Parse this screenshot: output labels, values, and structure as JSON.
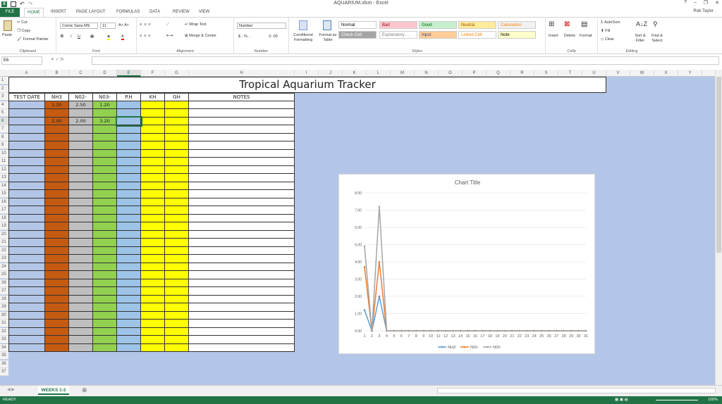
{
  "window": {
    "title": "AQUARIUM.xlsm - Excel",
    "user": "Rob Taylor"
  },
  "tabs": [
    "FILE",
    "HOME",
    "INSERT",
    "PAGE LAYOUT",
    "FORMULAS",
    "DATA",
    "REVIEW",
    "VIEW"
  ],
  "active_tab": "HOME",
  "ribbon": {
    "clipboard": {
      "paste": "Paste",
      "cut": "Cut",
      "copy": "Copy",
      "format_painter": "Format Painter",
      "label": "Clipboard"
    },
    "font": {
      "name": "Comic Sans MS",
      "size": "11",
      "label": "Font"
    },
    "alignment": {
      "wrap": "Wrap Text",
      "merge": "Merge & Center",
      "label": "Alignment"
    },
    "number": {
      "format": "Number",
      "label": "Number"
    },
    "styles": {
      "cond": "Conditional Formatting",
      "table": "Format as Table",
      "label": "Styles",
      "cells": [
        {
          "name": "Normal",
          "bg": "#ffffff",
          "fg": "#000000"
        },
        {
          "name": "Bad",
          "bg": "#ffc7ce",
          "fg": "#9c0006"
        },
        {
          "name": "Good",
          "bg": "#c6efce",
          "fg": "#006100"
        },
        {
          "name": "Neutral",
          "bg": "#ffeb9c",
          "fg": "#9c5700"
        },
        {
          "name": "Calculation",
          "bg": "#f2f2f2",
          "fg": "#fa7d00"
        },
        {
          "name": "Check Cell",
          "bg": "#a5a5a5",
          "fg": "#ffffff"
        },
        {
          "name": "Explanatory ...",
          "bg": "#ffffff",
          "fg": "#7f7f7f"
        },
        {
          "name": "Input",
          "bg": "#ffcc99",
          "fg": "#3f3f76"
        },
        {
          "name": "Linked Cell",
          "bg": "#ffffff",
          "fg": "#fa7d00"
        },
        {
          "name": "Note",
          "bg": "#ffffcc",
          "fg": "#000000"
        }
      ]
    },
    "cells": {
      "insert": "Insert",
      "delete": "Delete",
      "format": "Format",
      "label": "Cells"
    },
    "editing": {
      "autosum": "AutoSum",
      "fill": "Fill",
      "clear": "Clear",
      "sort": "Sort & Filter",
      "find": "Find & Select",
      "label": "Editing"
    }
  },
  "formula_bar": {
    "name_box": "E6",
    "fx": "fx",
    "value": ""
  },
  "columns": [
    "A",
    "B",
    "C",
    "D",
    "E",
    "F",
    "G",
    "H",
    "I",
    "J",
    "K",
    "L",
    "M",
    "N",
    "O",
    "P",
    "Q",
    "R",
    "S",
    "T",
    "U",
    "V",
    "W",
    "X",
    "Y"
  ],
  "selected_col": "E",
  "selected_row": 6,
  "sheet_title": "Tropical Aquarium Tracker",
  "table": {
    "headers": [
      "TEST DATE",
      "NH3",
      "N02-",
      "N03-",
      "P.H",
      "KH",
      "GH",
      "NOTES"
    ],
    "col_colors": [
      "#b4c6e7",
      "#c55a11",
      "#bfbfbf",
      "#92d050",
      "#9dc3e6",
      "#ffff00",
      "#ffff00",
      "#ffffff"
    ],
    "rows": {
      "4": [
        "",
        "1.20",
        "2.50",
        "1.20",
        "",
        "",
        "",
        ""
      ],
      "6": [
        "",
        "2.00",
        "2.00",
        "3.20",
        "",
        "",
        "",
        ""
      ]
    }
  },
  "chart_data": {
    "type": "line",
    "title": "Chart Title",
    "x": [
      1,
      2,
      3,
      4,
      5,
      6,
      7,
      8,
      9,
      10,
      11,
      12,
      13,
      14,
      15,
      16,
      17,
      18,
      19,
      20,
      21,
      22,
      23,
      24,
      25,
      26,
      27,
      28,
      29,
      30,
      31
    ],
    "ylim": [
      0,
      8
    ],
    "yticks": [
      "0.00",
      "1.00",
      "2.00",
      "3.00",
      "4.00",
      "5.00",
      "6.00",
      "7.00",
      "8.00"
    ],
    "series": [
      {
        "name": "NH3",
        "color": "#5b9bd5",
        "values": [
          1.2,
          0,
          2.0,
          0,
          0,
          0,
          0,
          0,
          0,
          0,
          0,
          0,
          0,
          0,
          0,
          0,
          0,
          0,
          0,
          0,
          0,
          0,
          0,
          0,
          0,
          0,
          0,
          0,
          0,
          0,
          0
        ]
      },
      {
        "name": "N02-",
        "color": "#ed7d31",
        "values": [
          3.7,
          0,
          4.0,
          0,
          0,
          0,
          0,
          0,
          0,
          0,
          0,
          0,
          0,
          0,
          0,
          0,
          0,
          0,
          0,
          0,
          0,
          0,
          0,
          0,
          0,
          0,
          0,
          0,
          0,
          0,
          0
        ]
      },
      {
        "name": "N03-",
        "color": "#a5a5a5",
        "values": [
          4.9,
          0,
          7.2,
          0,
          0,
          0,
          0,
          0,
          0,
          0,
          0,
          0,
          0,
          0,
          0,
          0,
          0,
          0,
          0,
          0,
          0,
          0,
          0,
          0,
          0,
          0,
          0,
          0,
          0,
          0,
          0
        ]
      }
    ],
    "grid": true,
    "legend": "bottom"
  },
  "sheet_tab": "WEEKS 1-2",
  "status": {
    "ready": "READY",
    "zoom": "100%"
  }
}
